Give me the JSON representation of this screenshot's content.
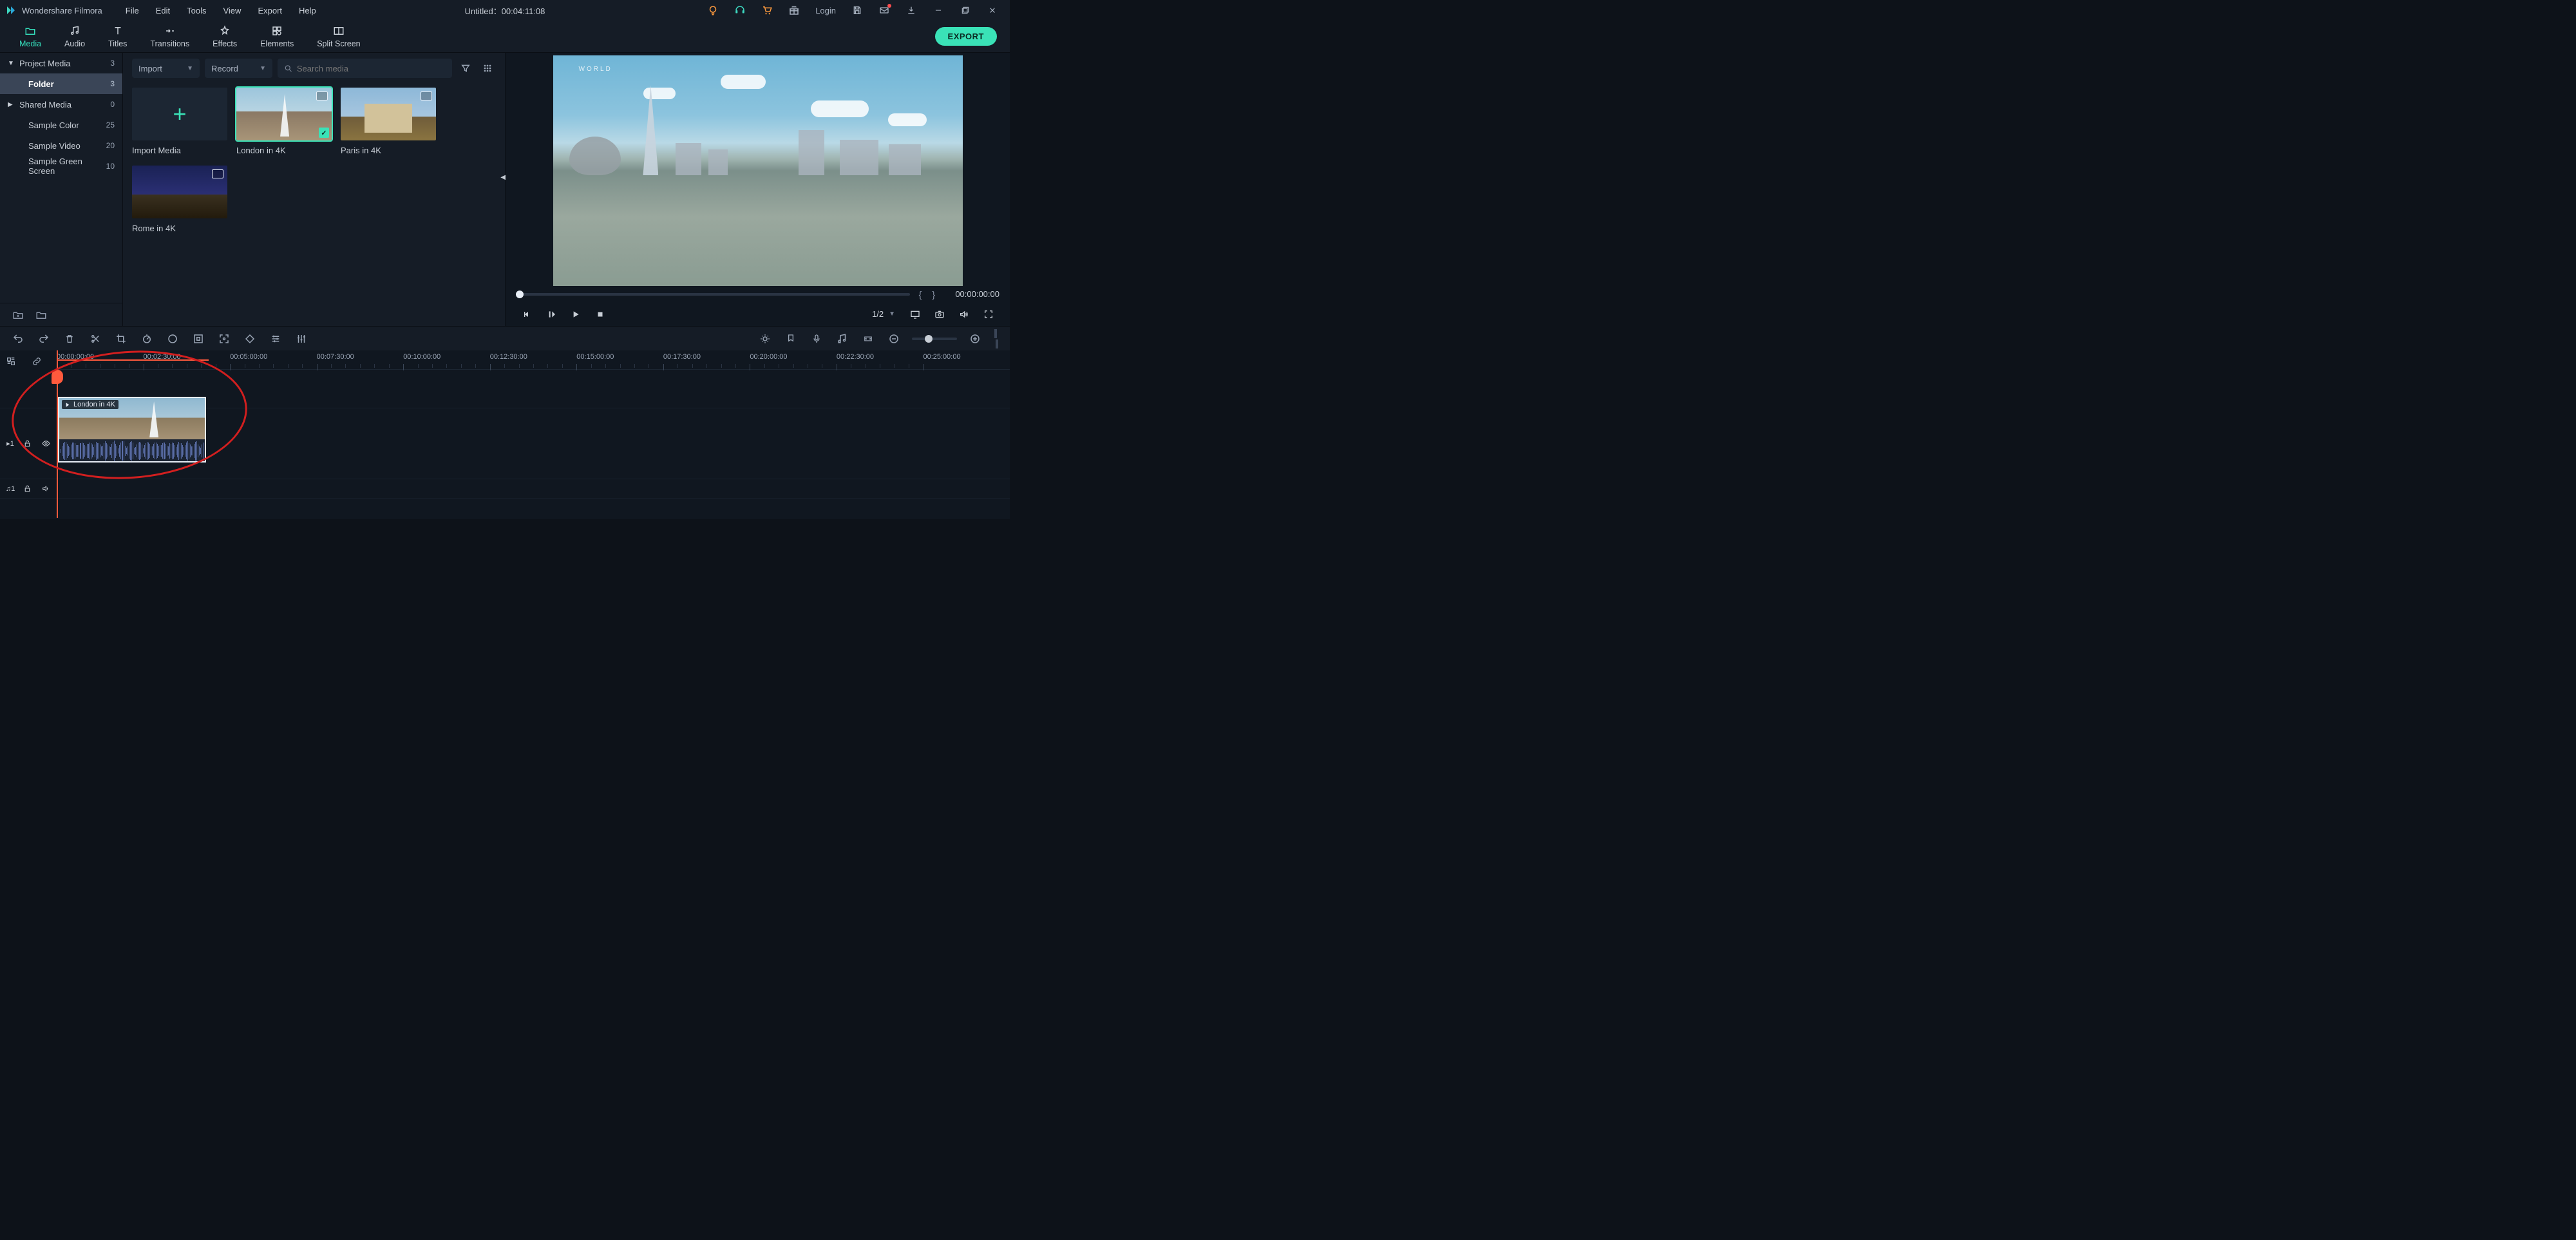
{
  "app": {
    "title": "Wondershare Filmora",
    "document": "Untitled：00:04:11:08"
  },
  "menu": {
    "file": "File",
    "edit": "Edit",
    "tools": "Tools",
    "view": "View",
    "export": "Export",
    "help": "Help"
  },
  "titlebar": {
    "login": "Login"
  },
  "tabs": {
    "media": "Media",
    "audio": "Audio",
    "titles": "Titles",
    "transitions": "Transitions",
    "effects": "Effects",
    "elements": "Elements",
    "split_screen": "Split Screen",
    "export_btn": "EXPORT"
  },
  "library_tree": {
    "project_media": {
      "label": "Project Media",
      "count": "3"
    },
    "folder": {
      "label": "Folder",
      "count": "3"
    },
    "shared_media": {
      "label": "Shared Media",
      "count": "0"
    },
    "sample_color": {
      "label": "Sample Color",
      "count": "25"
    },
    "sample_video": {
      "label": "Sample Video",
      "count": "20"
    },
    "sample_green": {
      "label": "Sample Green Screen",
      "count": "10"
    }
  },
  "media_toolbar": {
    "import": "Import",
    "record": "Record",
    "search_placeholder": "Search media"
  },
  "media_items": {
    "import_media": "Import Media",
    "london": "London in 4K",
    "paris": "Paris in 4K",
    "rome": "Rome in 4K"
  },
  "preview": {
    "watermark": "WORLD",
    "time": "00:00:00:00",
    "ratio": "1/2"
  },
  "ruler": {
    "ticks": [
      "00:00:00:00",
      "00:02:30:00",
      "00:05:00:00",
      "00:07:30:00",
      "00:10:00:00",
      "00:12:30:00",
      "00:15:00:00",
      "00:17:30:00",
      "00:20:00:00",
      "00:22:30:00",
      "00:25:00:00"
    ]
  },
  "track": {
    "video_label": "1",
    "audio_label": "1"
  },
  "clip": {
    "title": "London in 4K"
  }
}
